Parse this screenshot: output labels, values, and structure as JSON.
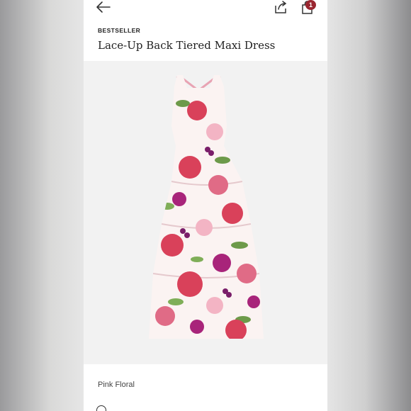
{
  "nav": {
    "back_icon": "arrow-left-icon",
    "share_icon": "share-icon",
    "bag_icon": "shopping-bag-icon",
    "bag_count": "1"
  },
  "product": {
    "eyebrow": "BESTSELLER",
    "title": "Lace-Up Back Tiered Maxi Dress",
    "color_name": "Pink Floral"
  },
  "colors": {
    "badge": "#9a2630",
    "image_bg": "#f2f2f2",
    "rose": "#d9415a",
    "magenta": "#a8247a",
    "leaf": "#6d9a4a",
    "blush": "#f3b4c4"
  },
  "info_row": {
    "icon": "circle-icon",
    "text": ""
  }
}
